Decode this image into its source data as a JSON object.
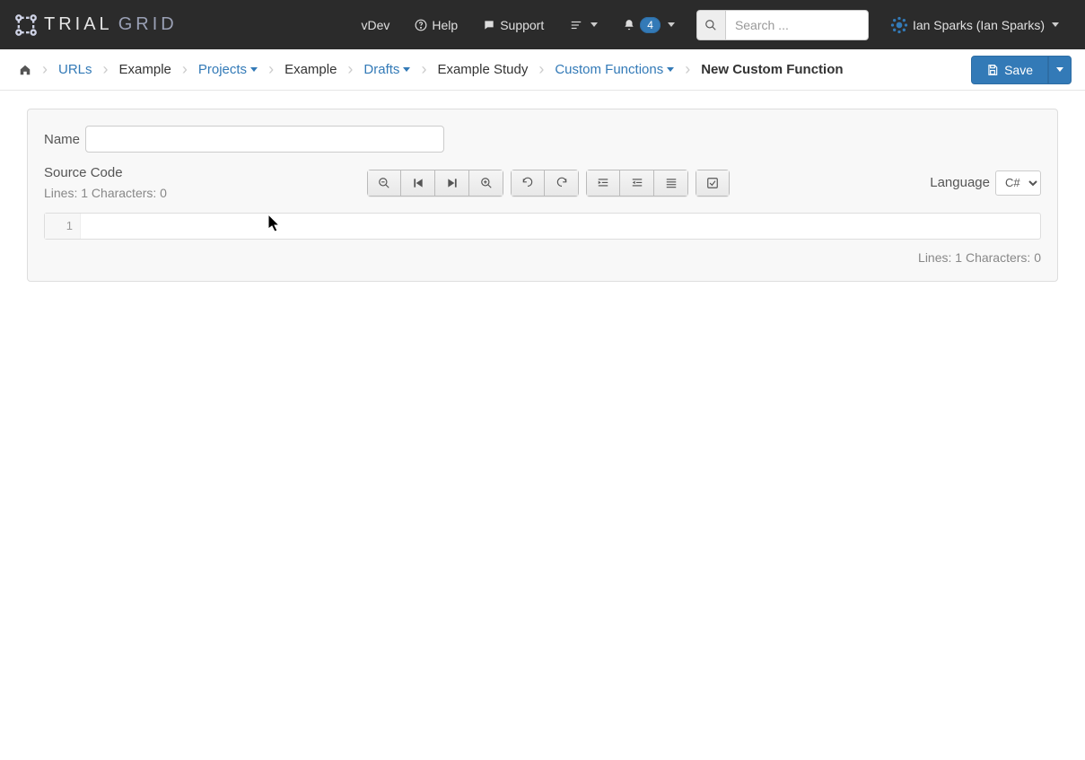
{
  "navbar": {
    "brand1": "TRIAL",
    "brand2": "GRID",
    "vdev": "vDev",
    "help": "Help",
    "support": "Support",
    "notification_count": "4",
    "search_placeholder": "Search ...",
    "user_name": "Ian Sparks (Ian Sparks)"
  },
  "breadcrumb": {
    "urls": "URLs",
    "example1": "Example",
    "projects": "Projects",
    "example2": "Example",
    "drafts": "Drafts",
    "study": "Example Study",
    "cfns": "Custom Functions",
    "current": "New Custom Function",
    "save": "Save"
  },
  "form": {
    "name_label": "Name",
    "name_value": "",
    "source_label": "Source Code",
    "lines_top": "Lines: 1 Characters: 0",
    "lines_bottom": "Lines: 1 Characters: 0",
    "language_label": "Language",
    "language_value": "C#",
    "line_number": "1",
    "code_content": ""
  }
}
